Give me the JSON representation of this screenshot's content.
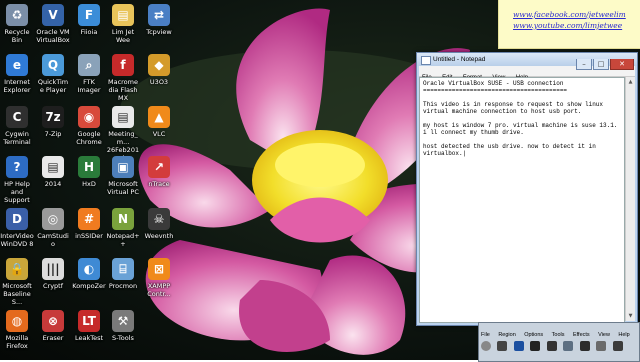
{
  "desktop": {
    "icons": [
      {
        "label": "Recycle Bin",
        "glyph": "♻",
        "color": "#7b8fa8"
      },
      {
        "label": "Oracle VM VirtualBox",
        "glyph": "V",
        "color": "#3463a8"
      },
      {
        "label": "Fiioia",
        "glyph": "F",
        "color": "#3b8dd8"
      },
      {
        "label": "Lim Jet Wee",
        "glyph": "▤",
        "color": "#e8c45a"
      },
      {
        "label": "Tcpview",
        "glyph": "⇄",
        "color": "#4a7fc4"
      },
      {
        "label": "Internet Explorer",
        "glyph": "e",
        "color": "#2f7ad6"
      },
      {
        "label": "QuickTime Player",
        "glyph": "Q",
        "color": "#4b9ad9"
      },
      {
        "label": "FTK Imager",
        "glyph": "⌕",
        "color": "#8aa2b9"
      },
      {
        "label": "Macromedia Flash MX",
        "glyph": "f",
        "color": "#c62a2a"
      },
      {
        "label": "U3O3",
        "glyph": "◆",
        "color": "#d49b2a"
      },
      {
        "label": "Cygwin Terminal",
        "glyph": "C",
        "color": "#2f2f2f"
      },
      {
        "label": "7-Zip",
        "glyph": "7z",
        "color": "#1e1e1e"
      },
      {
        "label": "Google Chrome",
        "glyph": "◉",
        "color": "#d84a3b"
      },
      {
        "label": "Meeting_m... 26Feb2014",
        "glyph": "▤",
        "color": "#e9e9e9"
      },
      {
        "label": "VLC",
        "glyph": "▲",
        "color": "#f08a1a"
      },
      {
        "label": "HP Help and Support",
        "glyph": "?",
        "color": "#2d6cc4"
      },
      {
        "label": "2014",
        "glyph": "▤",
        "color": "#e9e9e9"
      },
      {
        "label": "HxD",
        "glyph": "H",
        "color": "#2a7b3a"
      },
      {
        "label": "Microsoft Virtual PC",
        "glyph": "▣",
        "color": "#4d7fba"
      },
      {
        "label": "nTrace",
        "glyph": "↗",
        "color": "#d33c3c"
      },
      {
        "label": "InterVideo WinDVD 8",
        "glyph": "D",
        "color": "#3a5fa8"
      },
      {
        "label": "CamStudio",
        "glyph": "◎",
        "color": "#9a9a9a"
      },
      {
        "label": "inSSIDer",
        "glyph": "#",
        "color": "#f07b20"
      },
      {
        "label": "Notepad++",
        "glyph": "N",
        "color": "#7aa23c"
      },
      {
        "label": "Weevnth",
        "glyph": "☠",
        "color": "#3a3a3a"
      },
      {
        "label": "Microsoft Baseline S...",
        "glyph": "🔒",
        "color": "#c9a63a"
      },
      {
        "label": "Cryptf",
        "glyph": "|||",
        "color": "#dcdcdc"
      },
      {
        "label": "KompoZer",
        "glyph": "◐",
        "color": "#3f8ad4"
      },
      {
        "label": "Procmon",
        "glyph": "⌸",
        "color": "#6aa2d6"
      },
      {
        "label": "XAMPP Contr...",
        "glyph": "⊠",
        "color": "#f08a1a"
      },
      {
        "label": "Mozilla Firefox",
        "glyph": "◍",
        "color": "#e46a1d"
      },
      {
        "label": "Eraser",
        "glyph": "⊗",
        "color": "#c73a3a"
      },
      {
        "label": "LeakTest",
        "glyph": "LT",
        "color": "#c62a2a"
      },
      {
        "label": "S-Tools",
        "glyph": "⚒",
        "color": "#7a7a7a"
      }
    ]
  },
  "sticky_note": {
    "link1": "www.facebook.com/jetweelim",
    "link2": "www.youtube.com/limjetwee"
  },
  "notepad": {
    "title": "Untitled - Notepad",
    "menu": [
      "File",
      "Edit",
      "Format",
      "View",
      "Help"
    ],
    "content": "Oracle VirtualBox SUSE - USB connection\n========================================\n\nThis video is in response to request to show linux\nvirtual machine connection to host usb port.\n\nmy host is window 7 pro. virtual machine is suse 13.1.\ni ll connect my thumb drive.\n\nhost detected the usb drive. now to detect it in\nvirtualbox.|"
  },
  "recorder": {
    "menu": [
      "File",
      "Region",
      "Options",
      "Tools",
      "Effects",
      "View",
      "Help"
    ]
  }
}
